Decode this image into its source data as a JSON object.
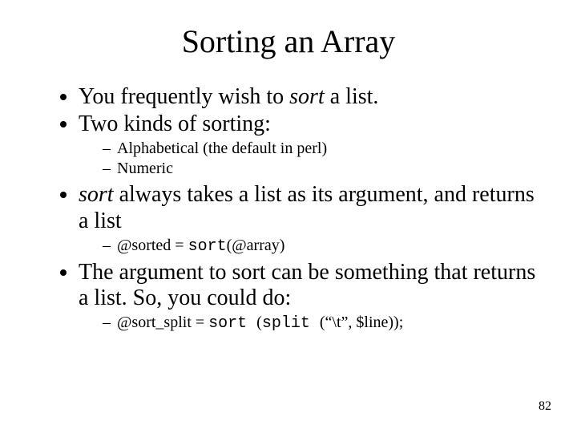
{
  "slide": {
    "title": "Sorting an Array",
    "bullets": [
      {
        "runs": [
          {
            "t": "You frequently wish to "
          },
          {
            "t": "sort",
            "italic": true
          },
          {
            "t": " a list."
          }
        ]
      },
      {
        "runs": [
          {
            "t": "Two kinds of sorting:"
          }
        ],
        "sub": [
          {
            "runs": [
              {
                "t": "Alphabetical (the default in perl)"
              }
            ]
          },
          {
            "runs": [
              {
                "t": "Numeric"
              }
            ]
          }
        ]
      },
      {
        "runs": [
          {
            "t": "sort",
            "italic": true
          },
          {
            "t": " always takes a list as its argument, and returns a list"
          }
        ],
        "sub": [
          {
            "runs": [
              {
                "t": "@sorted = "
              },
              {
                "t": "sort",
                "mono": true
              },
              {
                "t": "(@array)"
              }
            ]
          }
        ]
      },
      {
        "runs": [
          {
            "t": "The argument to sort can be something that returns a list.  So, you could do:"
          }
        ],
        "sub": [
          {
            "runs": [
              {
                "t": "@sort_split = "
              },
              {
                "t": "sort ",
                "mono": true
              },
              {
                "t": "("
              },
              {
                "t": "split ",
                "mono": true
              },
              {
                "t": "(“\\t”, $line));"
              }
            ]
          }
        ]
      }
    ],
    "page_number": "82"
  }
}
